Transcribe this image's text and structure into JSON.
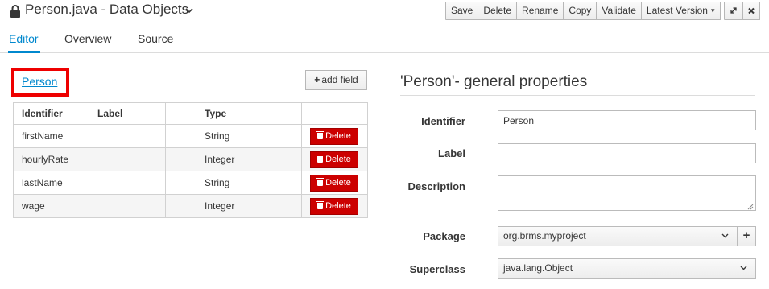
{
  "header": {
    "title": "Person.java - Data Objects",
    "lock_icon": "lock-icon",
    "actions": [
      "Save",
      "Delete",
      "Rename",
      "Copy",
      "Validate",
      "Latest Version"
    ],
    "window_controls": [
      "expand-icon",
      "close-icon"
    ]
  },
  "tabs": [
    {
      "label": "Editor",
      "active": true
    },
    {
      "label": "Overview",
      "active": false
    },
    {
      "label": "Source",
      "active": false
    }
  ],
  "object": {
    "name": "Person",
    "add_field_label": "add field"
  },
  "fields_table": {
    "headers": [
      "Identifier",
      "Label",
      "",
      "Type",
      ""
    ],
    "rows": [
      {
        "identifier": "firstName",
        "label": "",
        "type": "String"
      },
      {
        "identifier": "hourlyRate",
        "label": "",
        "type": "Integer"
      },
      {
        "identifier": "lastName",
        "label": "",
        "type": "String"
      },
      {
        "identifier": "wage",
        "label": "",
        "type": "Integer"
      }
    ],
    "delete_label": "Delete"
  },
  "properties": {
    "title": "'Person'- general properties",
    "identifier_label": "Identifier",
    "identifier_value": "Person",
    "label_label": "Label",
    "label_value": "",
    "description_label": "Description",
    "description_value": "",
    "package_label": "Package",
    "package_value": "org.brms.myproject",
    "superclass_label": "Superclass",
    "superclass_value": "java.lang.Object"
  },
  "colors": {
    "accent": "#0088ce",
    "danger": "#cc0000",
    "highlight_box": "#ee0000"
  }
}
